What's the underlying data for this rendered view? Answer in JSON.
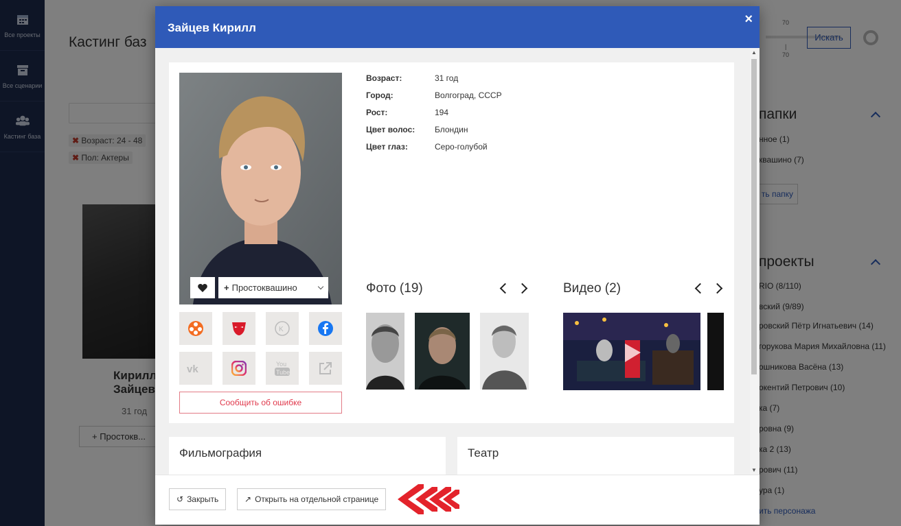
{
  "sidebar": {
    "items": [
      {
        "label": "Все проекты",
        "icon": "calendar-icon"
      },
      {
        "label": "Все сценарии",
        "icon": "archive-icon"
      },
      {
        "label": "Кастинг база",
        "icon": "users-icon"
      }
    ]
  },
  "background": {
    "page_title": "Кастинг баз",
    "filters": [
      "Возраст: 24 - 48",
      "Пол: Актеры"
    ],
    "card_name_line1": "Кирилл",
    "card_name_line2": "Зайцев",
    "card_age": "31 год",
    "card_button": "+ Простокв...",
    "slider_top": "70",
    "slider_mid": "|",
    "slider_bottom": "70",
    "search_button": "Искать",
    "folders_title": "папки",
    "folders": [
      "нное  (1)",
      "квашино  (7)"
    ],
    "folder_button": "ть папку",
    "projects_title": "проекты",
    "projects": [
      "RIO (8/110)",
      "вский (9/89)",
      "ровский Пётр Игнатьевич (14)",
      "горукова Мария Михайловна (11)",
      "ошникова Васёна (13)",
      "окентий Петрович (10)",
      "ка (7)",
      "ровна (9)",
      "ка 2 (13)",
      "рович (11)",
      "ура (1)"
    ],
    "add_character_link": "ить персонажа"
  },
  "modal": {
    "title": "Зайцев Кирилл",
    "close_label": "×",
    "dropdown_label": "Простоквашино",
    "report_error": "Сообщить об ошибке",
    "info": [
      {
        "label": "Возраст:",
        "value": "31 год"
      },
      {
        "label": "Город:",
        "value": "Волгоград, СССР"
      },
      {
        "label": "Рост:",
        "value": "194"
      },
      {
        "label": "Цвет волос:",
        "value": "Блондин"
      },
      {
        "label": "Цвет глаз:",
        "value": "Серо-голубой"
      }
    ],
    "photos_title": "Фото (19)",
    "videos_title": "Видео (2)",
    "filmography_title": "Фильмография",
    "theatre_title": "Театр",
    "footer": {
      "close_button": "Закрыть",
      "open_page_button": "Открыть на отдельной странице"
    },
    "social_icons": [
      "kinopoisk-icon",
      "mask-icon",
      "kinoteatr-icon",
      "facebook-icon",
      "vk-icon",
      "instagram-icon",
      "youtube-icon",
      "external-link-icon"
    ]
  },
  "colors": {
    "primary": "#2f5ab8",
    "sidebar": "#1d2b4d",
    "danger": "#e0394c"
  }
}
